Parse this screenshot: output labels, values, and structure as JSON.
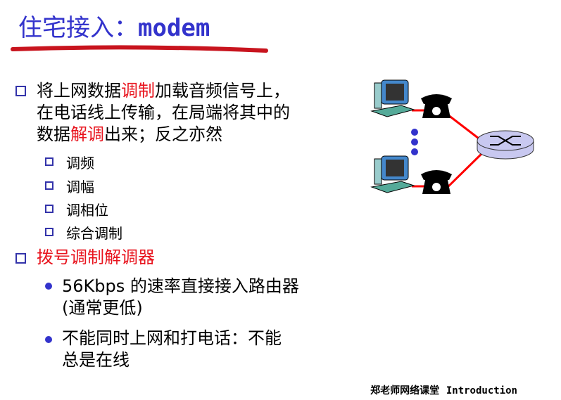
{
  "title": {
    "zh": "住宅接入：",
    "en": "modem"
  },
  "bullets": [
    {
      "lines": [
        [
          {
            "t": "将上网数据"
          },
          {
            "t": "调制",
            "red": true
          },
          {
            "t": "加载音频信号上，"
          }
        ],
        [
          {
            "t": "在电话线上传输，在局端将其中的"
          }
        ],
        [
          {
            "t": "数据"
          },
          {
            "t": "解调",
            "red": true
          },
          {
            "t": "出来；反之亦然"
          }
        ]
      ],
      "sub": [
        "调频",
        "调幅",
        "调相位",
        "综合调制"
      ]
    },
    {
      "label": "拨号调制解调器",
      "points": [
        {
          "lines": [
            "56Kbps 的速率直接接入路由器",
            "(通常更低)"
          ]
        },
        {
          "lines": [
            "不能同时上网和打电话：不能",
            "总是在线"
          ]
        }
      ]
    }
  ],
  "footer": {
    "zh": "郑老师网络课堂",
    "en": "Introduction"
  },
  "colors": {
    "title": "#3333cc",
    "accent": "#e8141e",
    "link": "#ff0000",
    "router": "#c8c8f0"
  }
}
